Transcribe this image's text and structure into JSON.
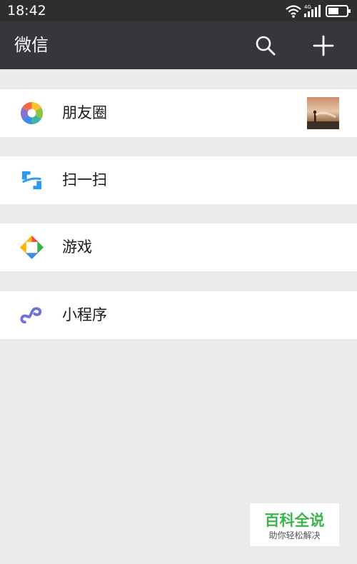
{
  "status_bar": {
    "time": "18:42",
    "network_label": "4G",
    "icons": [
      "wifi-icon",
      "signal-icon",
      "battery-icon"
    ]
  },
  "header": {
    "title": "微信",
    "actions": [
      "search-icon",
      "plus-icon"
    ]
  },
  "menu": {
    "items": [
      {
        "label": "朋友圈",
        "icon": "moments-icon",
        "has_thumbnail": true
      },
      {
        "label": "扫一扫",
        "icon": "scan-icon"
      },
      {
        "label": "游戏",
        "icon": "games-icon"
      },
      {
        "label": "小程序",
        "icon": "mini-program-icon"
      }
    ]
  },
  "watermark": {
    "title": "百科全说",
    "subtitle": "助你轻松解决"
  },
  "colors": {
    "status_bar_bg": "#2e2e30",
    "title_bar_bg": "#37373b",
    "page_bg": "#ebebeb",
    "row_bg": "#ffffff",
    "watermark_green": "#39b54a"
  }
}
